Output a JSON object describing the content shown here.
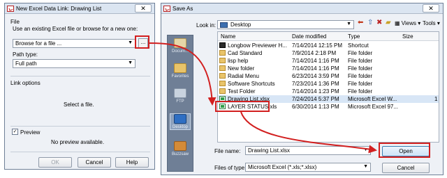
{
  "left_dialog": {
    "title": "New Excel Data Link: Drawing List",
    "close": "✕",
    "file_label": "File",
    "instruction": "Use an existing Excel file or browse for a new one:",
    "browse_value": "Browse for a file ...",
    "browse_button": "...",
    "path_type_label": "Path type:",
    "path_type_value": "Full path",
    "link_options_label": "Link options",
    "select_file_msg": "Select a file.",
    "preview_label": "Preview",
    "preview_checked": "✓",
    "no_preview": "No preview available.",
    "ok": "OK",
    "cancel": "Cancel",
    "help": "Help"
  },
  "right_dialog": {
    "title": "Save As",
    "close": "✕",
    "look_in_label": "Look in:",
    "look_in_value": "Desktop",
    "toolbar": {
      "views": "Views",
      "tools": "Tools"
    },
    "places": [
      "Docum...",
      "Favorites",
      "FTP",
      "Desktop",
      "Buzzsaw"
    ],
    "columns": [
      "Name",
      "Date modified",
      "Type",
      "Size"
    ],
    "files": [
      {
        "name": "Longbow Previewer H...",
        "date": "7/14/2014 12:15 PM",
        "type": "Shortcut",
        "size": "",
        "icon": "shortcut"
      },
      {
        "name": "Cad Standard",
        "date": "7/9/2014 2:18 PM",
        "type": "File folder",
        "size": "",
        "icon": "folder"
      },
      {
        "name": "lisp help",
        "date": "7/14/2014 1:16 PM",
        "type": "File folder",
        "size": "",
        "icon": "folder"
      },
      {
        "name": "New folder",
        "date": "7/14/2014 1:16 PM",
        "type": "File folder",
        "size": "",
        "icon": "folder"
      },
      {
        "name": "Radial Menu",
        "date": "6/23/2014 3:59 PM",
        "type": "File folder",
        "size": "",
        "icon": "folder"
      },
      {
        "name": "Software Shortcuts",
        "date": "7/23/2014 1:36 PM",
        "type": "File folder",
        "size": "",
        "icon": "folder"
      },
      {
        "name": "Test Folder",
        "date": "7/14/2014 1:23 PM",
        "type": "File folder",
        "size": "",
        "icon": "folder"
      },
      {
        "name": "Drawing List.xlsx",
        "date": "7/24/2014 5:37 PM",
        "type": "Microsoft Excel W...",
        "size": "1",
        "icon": "excel"
      },
      {
        "name": "LAYER STATUS.xls",
        "date": "6/30/2014 1:13 PM",
        "type": "Microsoft Excel 97...",
        "size": "",
        "icon": "excel"
      }
    ],
    "file_name_label": "File name:",
    "file_name_value": "Drawing List.xlsx",
    "files_of_type_label": "Files of type:",
    "files_of_type_value": "Microsoft Excel (*.xls;*.xlsx)",
    "open": "Open",
    "cancel": "Cancel"
  },
  "colors": {
    "highlight": "#d21f1f",
    "selection": "#d8e6f6"
  }
}
